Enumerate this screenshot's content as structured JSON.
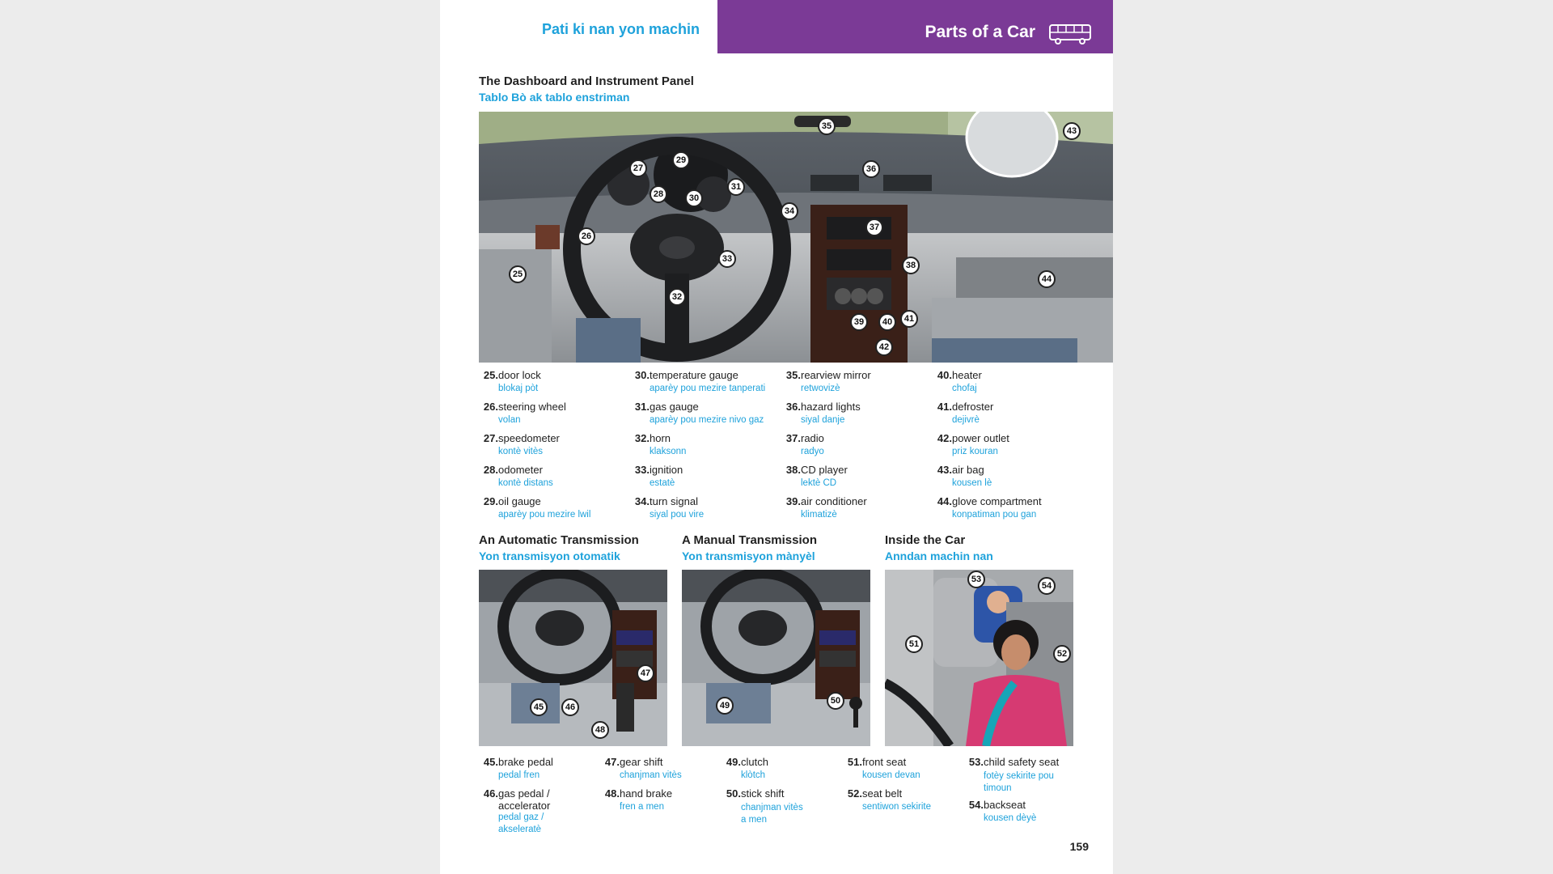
{
  "header": {
    "left_title": "Pati ki nan yon machin",
    "right_title": "Parts of a Car",
    "icon": "bus-icon",
    "band_color": "#7b3a96",
    "accent_color": "#1ea2db"
  },
  "dashboard": {
    "title": "The Dashboard and Instrument Panel",
    "subtitle": "Tablo Bò ak tablo enstriman",
    "callouts": [
      "25",
      "26",
      "27",
      "28",
      "29",
      "30",
      "31",
      "32",
      "33",
      "34",
      "35",
      "36",
      "37",
      "38",
      "39",
      "40",
      "41",
      "42",
      "43",
      "44"
    ],
    "items": [
      {
        "num": "25.",
        "en": "door lock",
        "ht": "blokaj pòt"
      },
      {
        "num": "26.",
        "en": "steering wheel",
        "ht": "volan"
      },
      {
        "num": "27.",
        "en": "speedometer",
        "ht": "kontè vitès"
      },
      {
        "num": "28.",
        "en": "odometer",
        "ht": "kontè distans"
      },
      {
        "num": "29.",
        "en": "oil gauge",
        "ht": "aparèy pou mezire lwil"
      },
      {
        "num": "30.",
        "en": "temperature gauge",
        "ht": "aparèy pou mezire tanperati"
      },
      {
        "num": "31.",
        "en": "gas gauge",
        "ht": "aparèy pou mezire nivo gaz"
      },
      {
        "num": "32.",
        "en": "horn",
        "ht": "klaksonn"
      },
      {
        "num": "33.",
        "en": "ignition",
        "ht": "estatè"
      },
      {
        "num": "34.",
        "en": "turn signal",
        "ht": "siyal pou vire"
      },
      {
        "num": "35.",
        "en": "rearview mirror",
        "ht": "retwovizè"
      },
      {
        "num": "36.",
        "en": "hazard lights",
        "ht": "siyal danje"
      },
      {
        "num": "37.",
        "en": "radio",
        "ht": "radyo"
      },
      {
        "num": "38.",
        "en": "CD player",
        "ht": "lektè CD"
      },
      {
        "num": "39.",
        "en": "air conditioner",
        "ht": "klimatizè"
      },
      {
        "num": "40.",
        "en": "heater",
        "ht": "chofaj"
      },
      {
        "num": "41.",
        "en": "defroster",
        "ht": "dejivrè"
      },
      {
        "num": "42.",
        "en": "power outlet",
        "ht": "priz kouran"
      },
      {
        "num": "43.",
        "en": "air bag",
        "ht": "kousen lè"
      },
      {
        "num": "44.",
        "en": "glove compartment",
        "ht": "konpatiman pou gan"
      }
    ]
  },
  "automatic": {
    "title": "An Automatic Transmission",
    "subtitle": "Yon transmisyon otomatik",
    "callouts": [
      "45",
      "46",
      "47",
      "48"
    ]
  },
  "manual": {
    "title": "A Manual Transmission",
    "subtitle": "Yon transmisyon mànyèl",
    "callouts": [
      "49",
      "50"
    ]
  },
  "inside": {
    "title": "Inside the Car",
    "subtitle": "Anndan machin nan",
    "callouts": [
      "51",
      "52",
      "53",
      "54"
    ]
  },
  "bottom_items": [
    {
      "num": "45.",
      "en": "brake pedal",
      "ht": "pedal fren"
    },
    {
      "num": "46.",
      "en": "gas pedal / accelerator",
      "ht": "pedal gaz / akseleratè"
    },
    {
      "num": "47.",
      "en": "gear shift",
      "ht": "chanjman vitès"
    },
    {
      "num": "48.",
      "en": "hand brake",
      "ht": "fren a men"
    },
    {
      "num": "49.",
      "en": "clutch",
      "ht": "klòtch"
    },
    {
      "num": "50.",
      "en": "stick shift",
      "ht": "chanjman vitès a men"
    },
    {
      "num": "51.",
      "en": "front seat",
      "ht": "kousen devan"
    },
    {
      "num": "52.",
      "en": "seat belt",
      "ht": "sentiwon sekirite"
    },
    {
      "num": "53.",
      "en": "child safety seat",
      "ht": "fotèy sekirite pou timoun"
    },
    {
      "num": "54.",
      "en": "backseat",
      "ht": "kousen dèyè"
    }
  ],
  "page_number": "159"
}
